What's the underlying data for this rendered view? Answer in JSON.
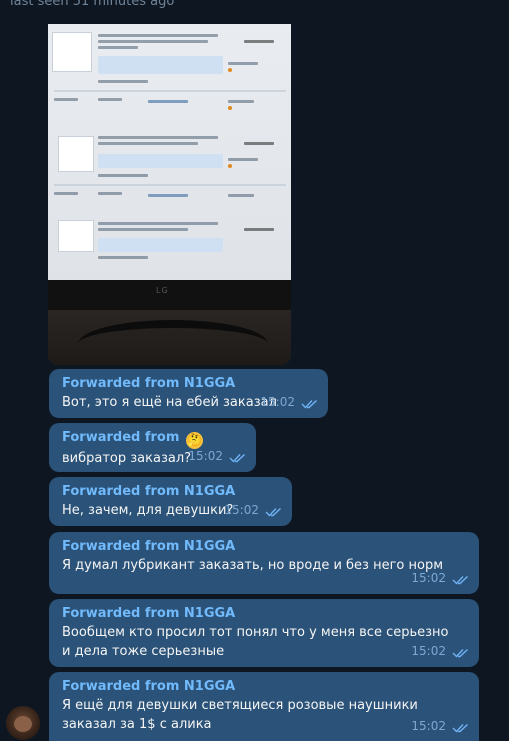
{
  "chat": {
    "status": "last seen 51 minutes ago"
  },
  "photo": {
    "logo": "LG"
  },
  "messages": [
    {
      "forwarded_from": "Forwarded from N1GGA",
      "emoji": "",
      "text": "Вот, это я ещё на ебей заказал",
      "time": "15:02"
    },
    {
      "forwarded_from": "Forwarded from",
      "emoji": "🤔",
      "text": "вибратор заказал?",
      "time": "15:02"
    },
    {
      "forwarded_from": "Forwarded from N1GGA",
      "emoji": "",
      "text": "Не, зачем, для девушки?",
      "time": "15:02"
    },
    {
      "forwarded_from": "Forwarded from N1GGA",
      "emoji": "",
      "text": "Я думал лубрикант заказать, но вроде и без него норм",
      "time": "15:02"
    },
    {
      "forwarded_from": "Forwarded from N1GGA",
      "emoji": "",
      "text": "Вообщем кто просил тот понял что у меня все серьезно и дела тоже серьезные",
      "time": "15:02"
    },
    {
      "forwarded_from": "Forwarded from N1GGA",
      "emoji": "",
      "text": "Я ещё для девушки светящиеся розовые наушники заказал за 1$ с алика",
      "time": "15:02"
    }
  ],
  "icons": {
    "read_receipt": "double-check-icon"
  },
  "colors": {
    "background": "#0e1621",
    "bubble": "#2b5278",
    "sender": "#71bafc",
    "meta": "#7da8d3"
  }
}
